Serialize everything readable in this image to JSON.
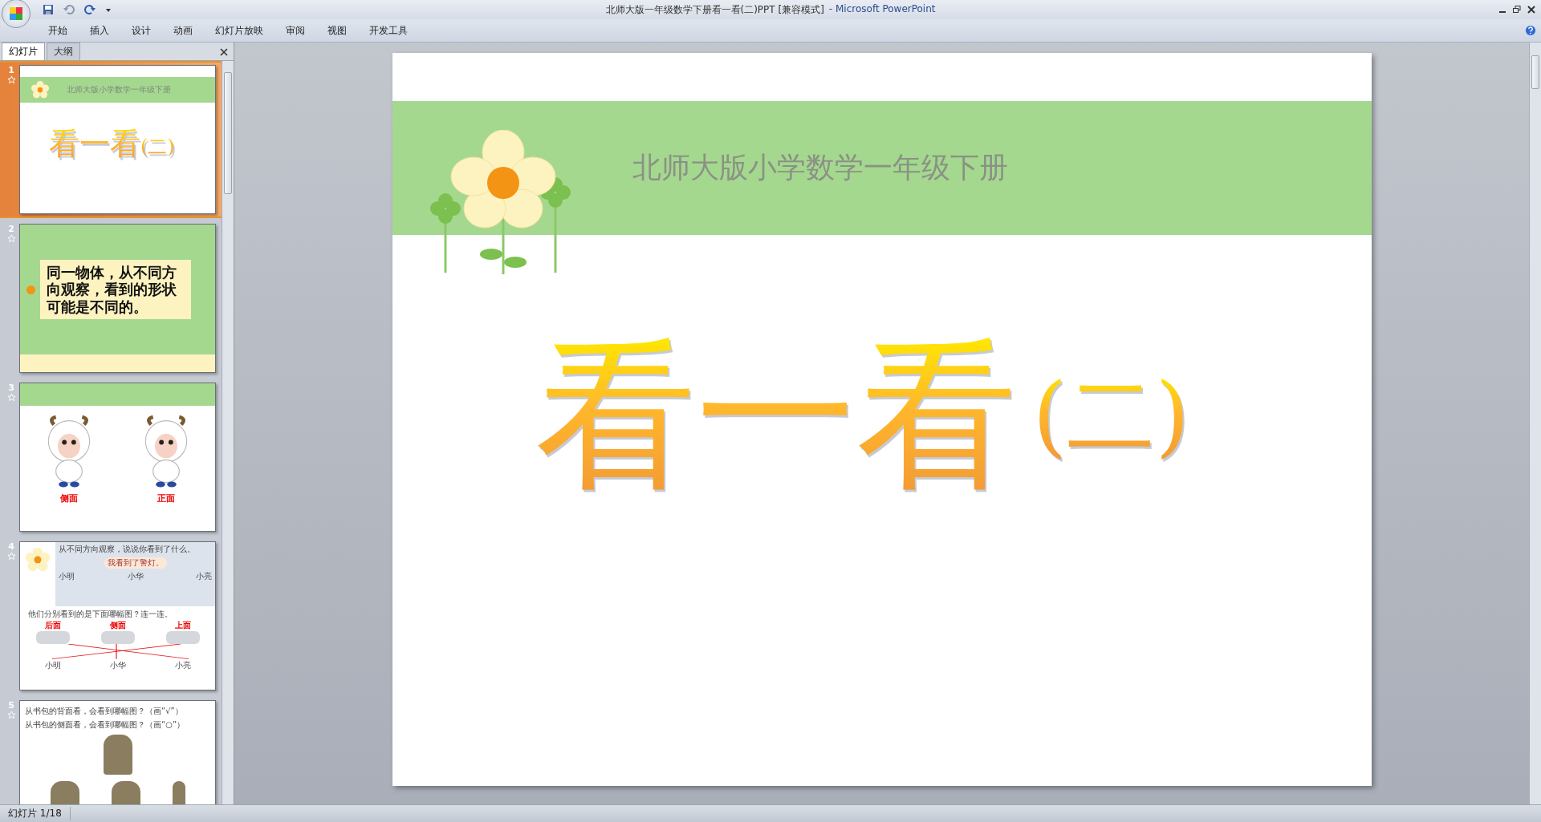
{
  "window": {
    "title": "北师大版一年级数学下册看一看(二)PPT [兼容模式]",
    "app_name": "- Microsoft PowerPoint"
  },
  "ribbon_tabs": [
    "开始",
    "插入",
    "设计",
    "动画",
    "幻灯片放映",
    "审阅",
    "视图",
    "开发工具"
  ],
  "panel_tabs": [
    {
      "label": "幻灯片",
      "selected": true
    },
    {
      "label": "大纲",
      "selected": false
    }
  ],
  "thumbnails": [
    {
      "number": "1",
      "selected": true,
      "kind": "title",
      "subtitle": "北师大版小学数学一年级下册",
      "title": "看一看",
      "title_suffix": "(二)"
    },
    {
      "number": "2",
      "selected": false,
      "kind": "text",
      "text": "同一物体，从不同方向观察，看到的形状可能是不同的。"
    },
    {
      "number": "3",
      "selected": false,
      "kind": "pictures",
      "labels": [
        "侧面",
        "正面"
      ]
    },
    {
      "number": "4",
      "selected": false,
      "kind": "matching",
      "prompt": "从不同方向观察，说说你看到了什么。",
      "speech": "我看到了警灯。",
      "people": [
        "小明",
        "小华",
        "小亮"
      ],
      "question": "他们分别看到的是下面哪幅图？连一连。",
      "views": [
        "后面",
        "侧面",
        "上面"
      ],
      "answers": [
        "小明",
        "小华",
        "小亮"
      ]
    },
    {
      "number": "5",
      "selected": false,
      "kind": "question",
      "lines": [
        "从书包的背面看，会看到哪幅图？（画“√”）",
        "从书包的侧面看，会看到哪幅图？（画“○”）"
      ]
    }
  ],
  "slide": {
    "subtitle": "北师大版小学数学一年级下册",
    "title": "看一看",
    "title_suffix": "(二)"
  },
  "status_bar": {
    "slide_counter": "幻灯片 1/18"
  }
}
